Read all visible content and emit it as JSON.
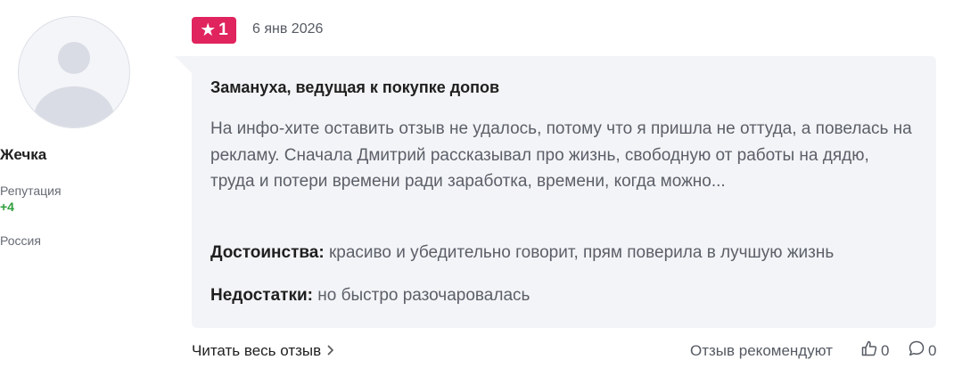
{
  "user": {
    "name": "Жечка",
    "reputation_label": "Репутация",
    "reputation_value": "+4",
    "country": "Россия"
  },
  "review": {
    "rating": "1",
    "date": "6 янв 2026",
    "title": "Замануха, ведущая к покупке допов",
    "text": "На инфо-хите оставить отзыв не удалось, потому что я пришла не оттуда, а повелась на рекламу. Сначала Дмитрий рассказывал про жизнь, свободную от работы на дядю, труда и потери времени ради заработка, времени, когда можно...",
    "pros_label": "Достоинства:",
    "pros_text": " красиво и убедительно говорит, прям поверила в лучшую жизнь",
    "cons_label": "Недостатки:",
    "cons_text": " но быстро разочаровалась"
  },
  "footer": {
    "read_more": "Читать весь отзыв",
    "recommend_label": "Отзыв рекомендуют",
    "likes": "0",
    "comments": "0"
  },
  "colors": {
    "rating_badge": "#e0245e",
    "reputation_positive": "#2e9e3c",
    "review_bg": "#f3f4f7"
  },
  "icons": [
    "star-icon",
    "chevron-right-icon",
    "thumbs-up-icon",
    "comment-icon",
    "avatar-placeholder"
  ]
}
